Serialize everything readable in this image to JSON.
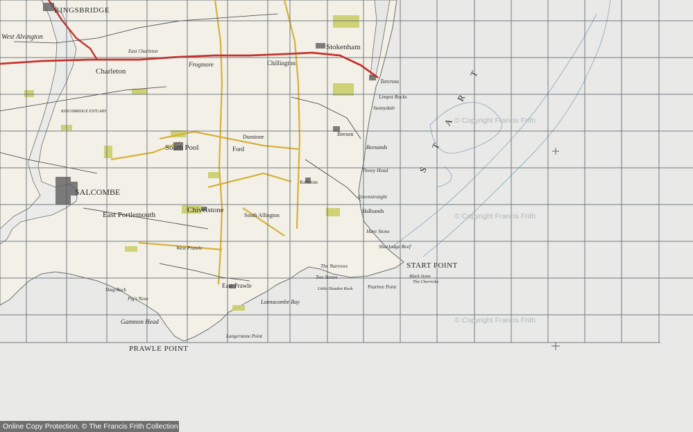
{
  "map": {
    "colors": {
      "paper": "#e6e6e3",
      "sea": "#e9e9e7",
      "land": "#f1efe6",
      "grid": "#5e6670",
      "road_main": "#c8322c",
      "road_minor": "#d7b13a",
      "woodland": "#c9cc62",
      "water_line": "#7d9fb8"
    },
    "labels": {
      "kingsbridge": "KINGSBRIDGE",
      "west_alvington": "West Alvington",
      "charleton": "Charleton",
      "east_charleton": "East Charleton",
      "frogmore": "Frogmore",
      "chillington": "Chillington",
      "stokenham": "Stokenham",
      "torcross": "Torcross",
      "start_bay": "S T A R T",
      "south_pool": "South Pool",
      "kingsbridge_estuary": "KINGSBRIDGE ESTUARY",
      "ford": "Ford",
      "dunstone": "Dunstone",
      "beeson": "Beeson",
      "beesands": "Beesands",
      "limpet_rocks": "Limpet Rocks",
      "sunnydale": "Sunnydale",
      "tinsey_head": "Tinsey Head",
      "kellaton": "Kellaton",
      "greenstraight": "Greenstraight",
      "hallsands": "Hallsands",
      "salcombe": "SALCOMBE",
      "east_portlemouth": "East Portlemouth",
      "chivelstone": "Chivelstone",
      "south_allington": "South Allington",
      "start_point": "START POINT",
      "hare_stone": "Hare Stone",
      "sharlodge_reef": "Sharlodge Reef",
      "the_narrows": "The Narrows",
      "two_stones": "Two Stones",
      "peartree_point": "Peartree Point",
      "black_stone": "Black Stone",
      "the_cherricks": "The Cherricks",
      "lannacombe_bay": "Lannacombe Bay",
      "east_prawle": "East Prawle",
      "gammon_head": "Gammon Head",
      "prawle_point": "PRAWLE POINT",
      "langerstone_point": "Langerstone Point",
      "shag_rock": "Shag Rock",
      "pig_s_nose": "Pig's Nose",
      "west_prawle": "West Prawle",
      "sleaden_rock": "Little Sleaden Rock"
    },
    "watermarks": [
      "© Copyright Francis Frith",
      "© Copyright Francis Frith",
      "© Copyright Francis Frith"
    ]
  },
  "footer": {
    "text": "Online Copy Protection. © The Francis Frith Collection"
  }
}
